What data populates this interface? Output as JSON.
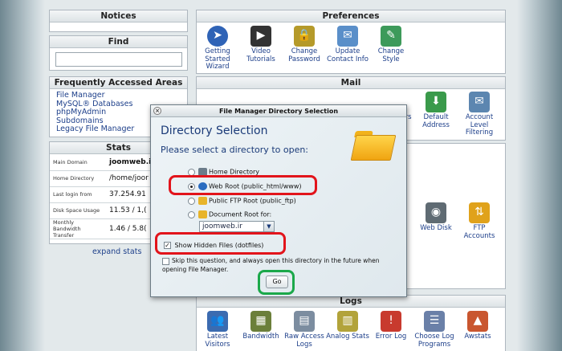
{
  "left": {
    "notices_title": "Notices",
    "find_title": "Find",
    "find_value": "",
    "faa_title": "Frequently Accessed Areas",
    "faa_links": [
      "File Manager",
      "MySQL® Databases",
      "phpMyAdmin",
      "Subdomains",
      "Legacy File Manager"
    ],
    "stats_title": "Stats",
    "stats": [
      {
        "k": "Main Domain",
        "v": "joomweb.i"
      },
      {
        "k": "Home Directory",
        "v": "/home/joor"
      },
      {
        "k": "Last login from",
        "v": "37.254.91"
      },
      {
        "k": "Disk Space Usage",
        "v": "11.53 / 1,("
      },
      {
        "k": "Monthly Bandwidth Transfer",
        "v": "1.46 / 5.8("
      }
    ],
    "expand_stats": "expand stats"
  },
  "preferences": {
    "title": "Preferences",
    "items": [
      {
        "label": "Getting Started Wizard",
        "icon": "wizard-icon",
        "color": "#2f63b6"
      },
      {
        "label": "Video Tutorials",
        "icon": "clapperboard-icon",
        "color": "#333333"
      },
      {
        "label": "Change Password",
        "icon": "lock-icon",
        "color": "#b59a2a"
      },
      {
        "label": "Update Contact Info",
        "icon": "contact-icon",
        "color": "#5a8fc9"
      },
      {
        "label": "Change Style",
        "icon": "palette-icon",
        "color": "#3d9a5a"
      }
    ]
  },
  "mail": {
    "title": "Mail",
    "items": [
      {
        "label": "ers",
        "icon": "forwarders-icon",
        "color": "#4b7fb8"
      },
      {
        "label": "Default Address",
        "icon": "default-address-icon",
        "color": "#3a9a4b"
      },
      {
        "label": "Account Level Filtering",
        "icon": "filter-icon",
        "color": "#5c86b0"
      }
    ]
  },
  "files": {
    "items": [
      {
        "label": "Web Disk",
        "icon": "web-disk-icon",
        "color": "#5f6b73"
      },
      {
        "label": "FTP Accounts",
        "icon": "ftp-icon",
        "color": "#e0a21b"
      }
    ]
  },
  "logs": {
    "title": "Logs",
    "items": [
      {
        "label": "Latest Visitors",
        "icon": "visitors-icon",
        "color": "#3b6bb0"
      },
      {
        "label": "Bandwidth",
        "icon": "bandwidth-icon",
        "color": "#6b7f3a"
      },
      {
        "label": "Raw Access Logs",
        "icon": "raw-logs-icon",
        "color": "#7c8da0"
      },
      {
        "label": "Analog Stats",
        "icon": "analog-icon",
        "color": "#b2a33a"
      },
      {
        "label": "Error Log",
        "icon": "error-log-icon",
        "color": "#c83a2e"
      },
      {
        "label": "Choose Log Programs",
        "icon": "log-programs-icon",
        "color": "#6a80a8"
      },
      {
        "label": "Awstats",
        "icon": "awstats-icon",
        "color": "#c9562f"
      }
    ]
  },
  "dialog": {
    "title": "File Manager Directory Selection",
    "heading": "Directory Selection",
    "prompt": "Please select a directory to open:",
    "opt_home": "Home Directory",
    "opt_webroot": "Web Root (public_html/www)",
    "opt_ftp": "Public FTP Root (public_ftp)",
    "opt_docroot": "Document Root for:",
    "domain_value": "joomweb.ir",
    "show_hidden": "Show Hidden Files (dotfiles)",
    "skip_text": "Skip this question, and always open this directory in the future when opening File Manager.",
    "go_label": "Go",
    "selected": "webroot"
  }
}
